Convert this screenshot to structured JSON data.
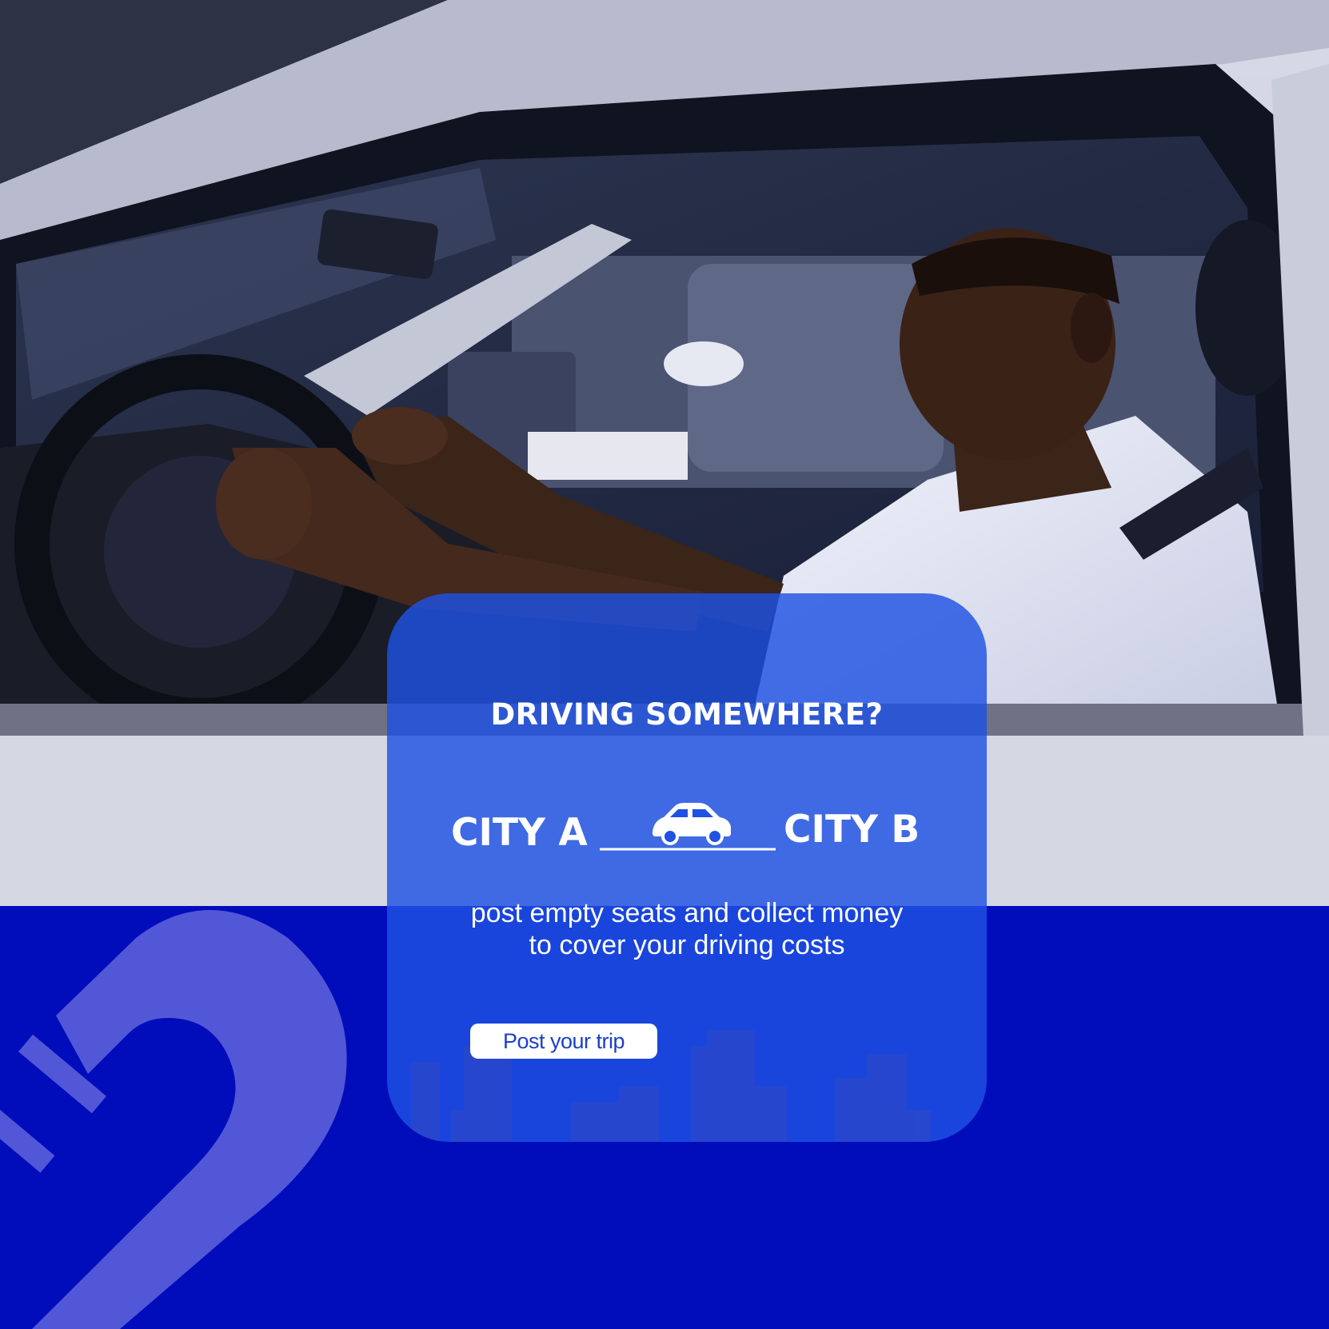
{
  "colors": {
    "band": "#010dbb",
    "card": "#1f52e3",
    "text": "#ffffff",
    "button_text": "#1b3fc7",
    "deco": "#5157d6"
  },
  "card": {
    "title": "DRIVING SOMEWHERE?",
    "route": {
      "from": "CITY A",
      "to": "CITY B",
      "icon": "car-icon"
    },
    "description_lines": [
      "post empty seats and collect money",
      "to cover your driving costs"
    ],
    "cta_label": "Post your trip"
  }
}
